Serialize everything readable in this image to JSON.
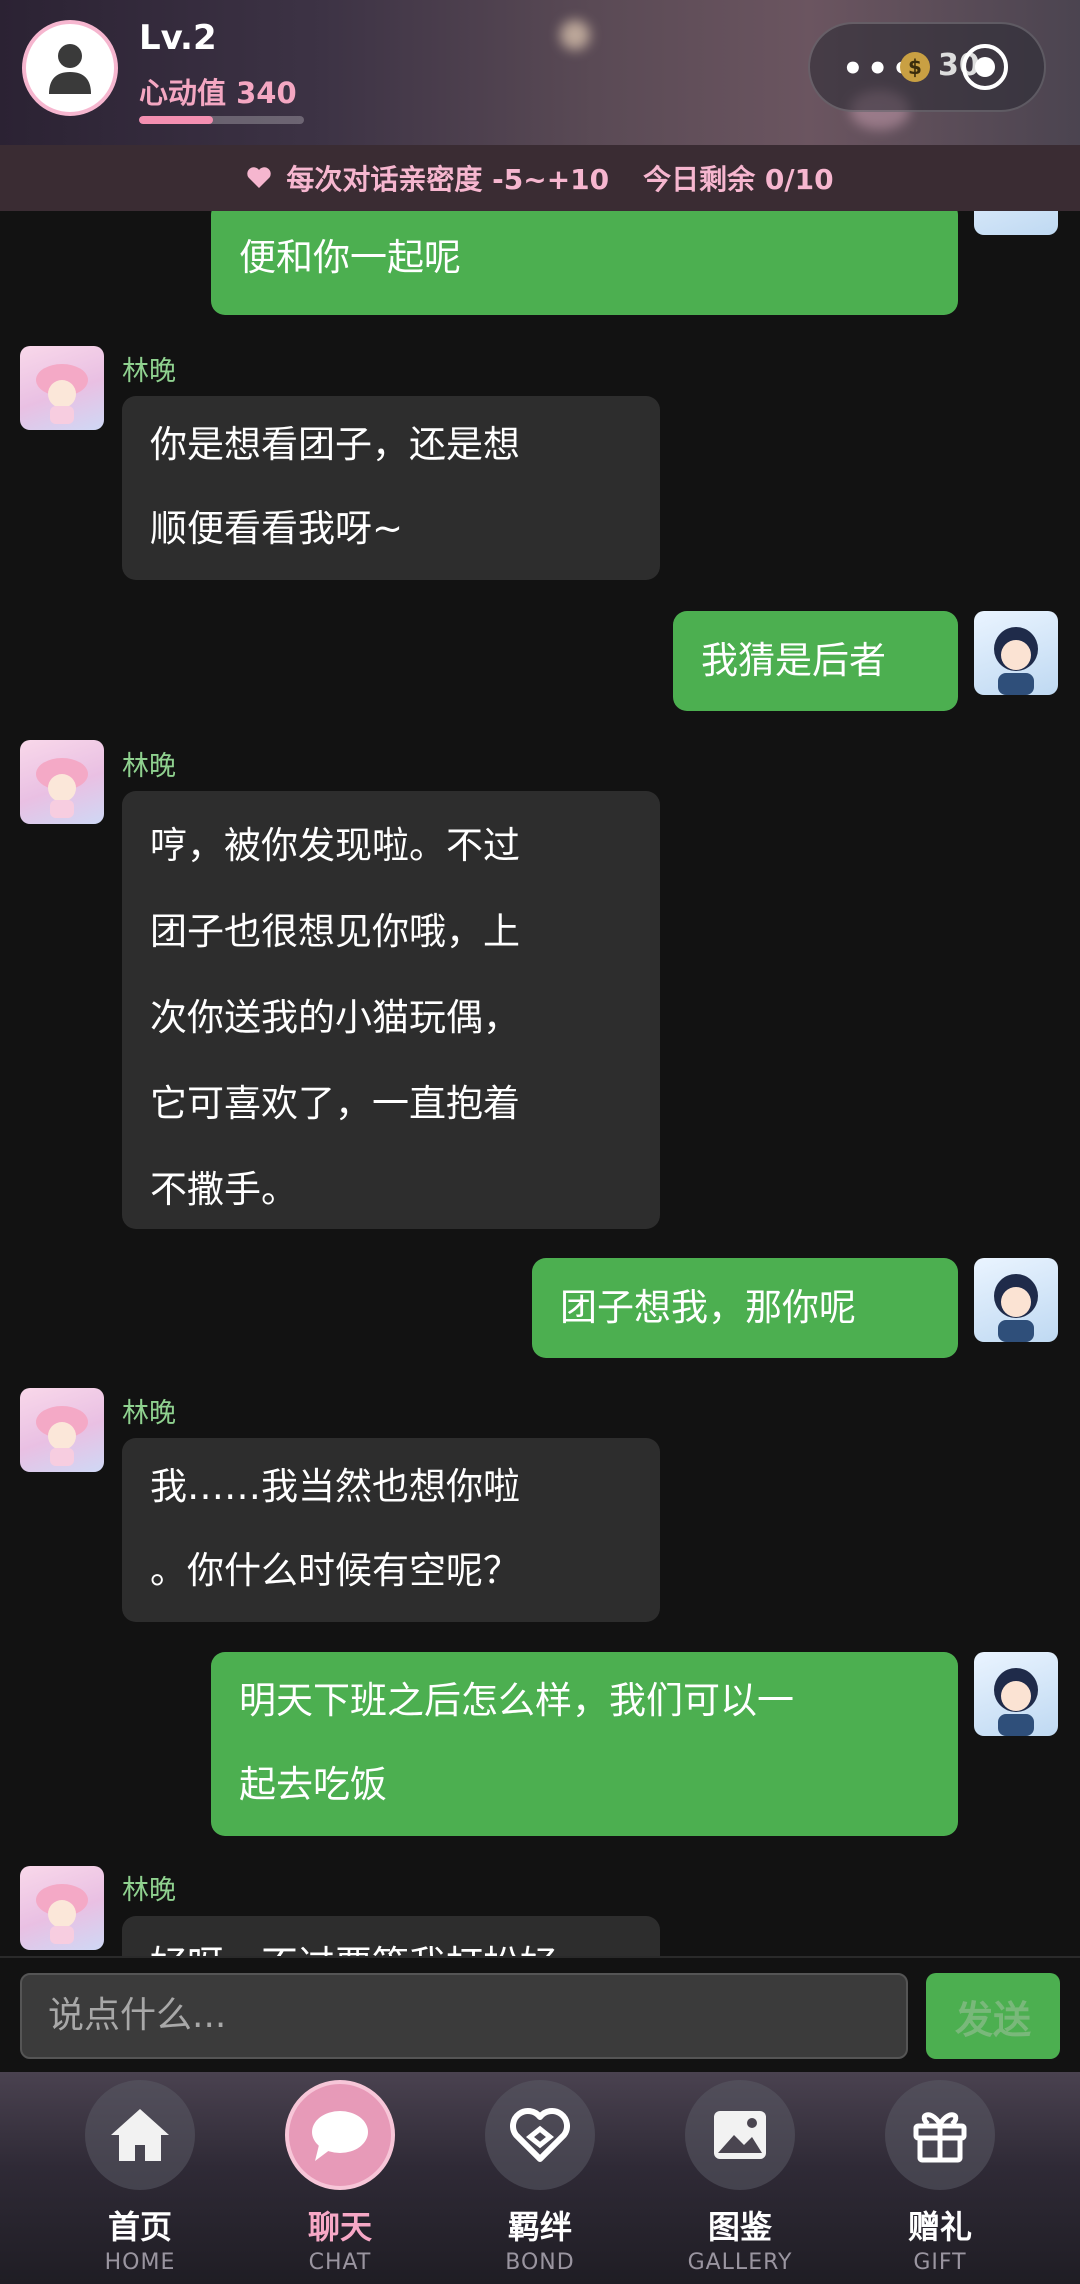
{
  "header": {
    "level": "Lv.2",
    "heart_value_label": "心动值 340",
    "heart_progress": 0.45,
    "coin_value": "30"
  },
  "banner": {
    "intimacy_text": "每次对话亲密度 -5~+10",
    "remaining_text": "今日剩余 0/10"
  },
  "messages": [
    {
      "from": "me",
      "lines": [
        "便和你一起呢"
      ]
    },
    {
      "from": "her",
      "name": "林晚",
      "lines": [
        "你是想看团子，还是想",
        "顺便看看我呀~"
      ]
    },
    {
      "from": "me",
      "lines": [
        "我猜是后者"
      ]
    },
    {
      "from": "her",
      "name": "林晚",
      "lines": [
        "哼，被你发现啦。不过",
        "团子也很想见你哦，上",
        "次你送我的小猫玩偶，",
        "它可喜欢了，一直抱着",
        "不撒手。"
      ]
    },
    {
      "from": "me",
      "lines": [
        "团子想我，那你呢"
      ]
    },
    {
      "from": "her",
      "name": "林晚",
      "lines": [
        "我……我当然也想你啦",
        "。你什么时候有空呢？"
      ]
    },
    {
      "from": "me",
      "lines": [
        "明天下班之后怎么样，我们可以一",
        "起去吃饭"
      ]
    },
    {
      "from": "her",
      "name": "林晚",
      "lines": [
        "好呀，不过要等我打扮好"
      ]
    }
  ],
  "input": {
    "placeholder": "说点什么...",
    "send_label": "发送"
  },
  "nav": [
    {
      "label": "首页",
      "sub": "HOME",
      "icon": "home-icon",
      "active": false
    },
    {
      "label": "聊天",
      "sub": "CHAT",
      "icon": "chat-bubble-icon",
      "active": true
    },
    {
      "label": "羁绊",
      "sub": "BOND",
      "icon": "heart-link-icon",
      "active": false
    },
    {
      "label": "图鉴",
      "sub": "GALLERY",
      "icon": "gallery-icon",
      "active": false
    },
    {
      "label": "赠礼",
      "sub": "GIFT",
      "icon": "gift-icon",
      "active": false
    }
  ],
  "colors": {
    "accent_pink": "#f6b6cf",
    "my_bubble": "#4caf50",
    "their_bubble": "#2d2d2d",
    "name_green": "#8fd18f"
  }
}
